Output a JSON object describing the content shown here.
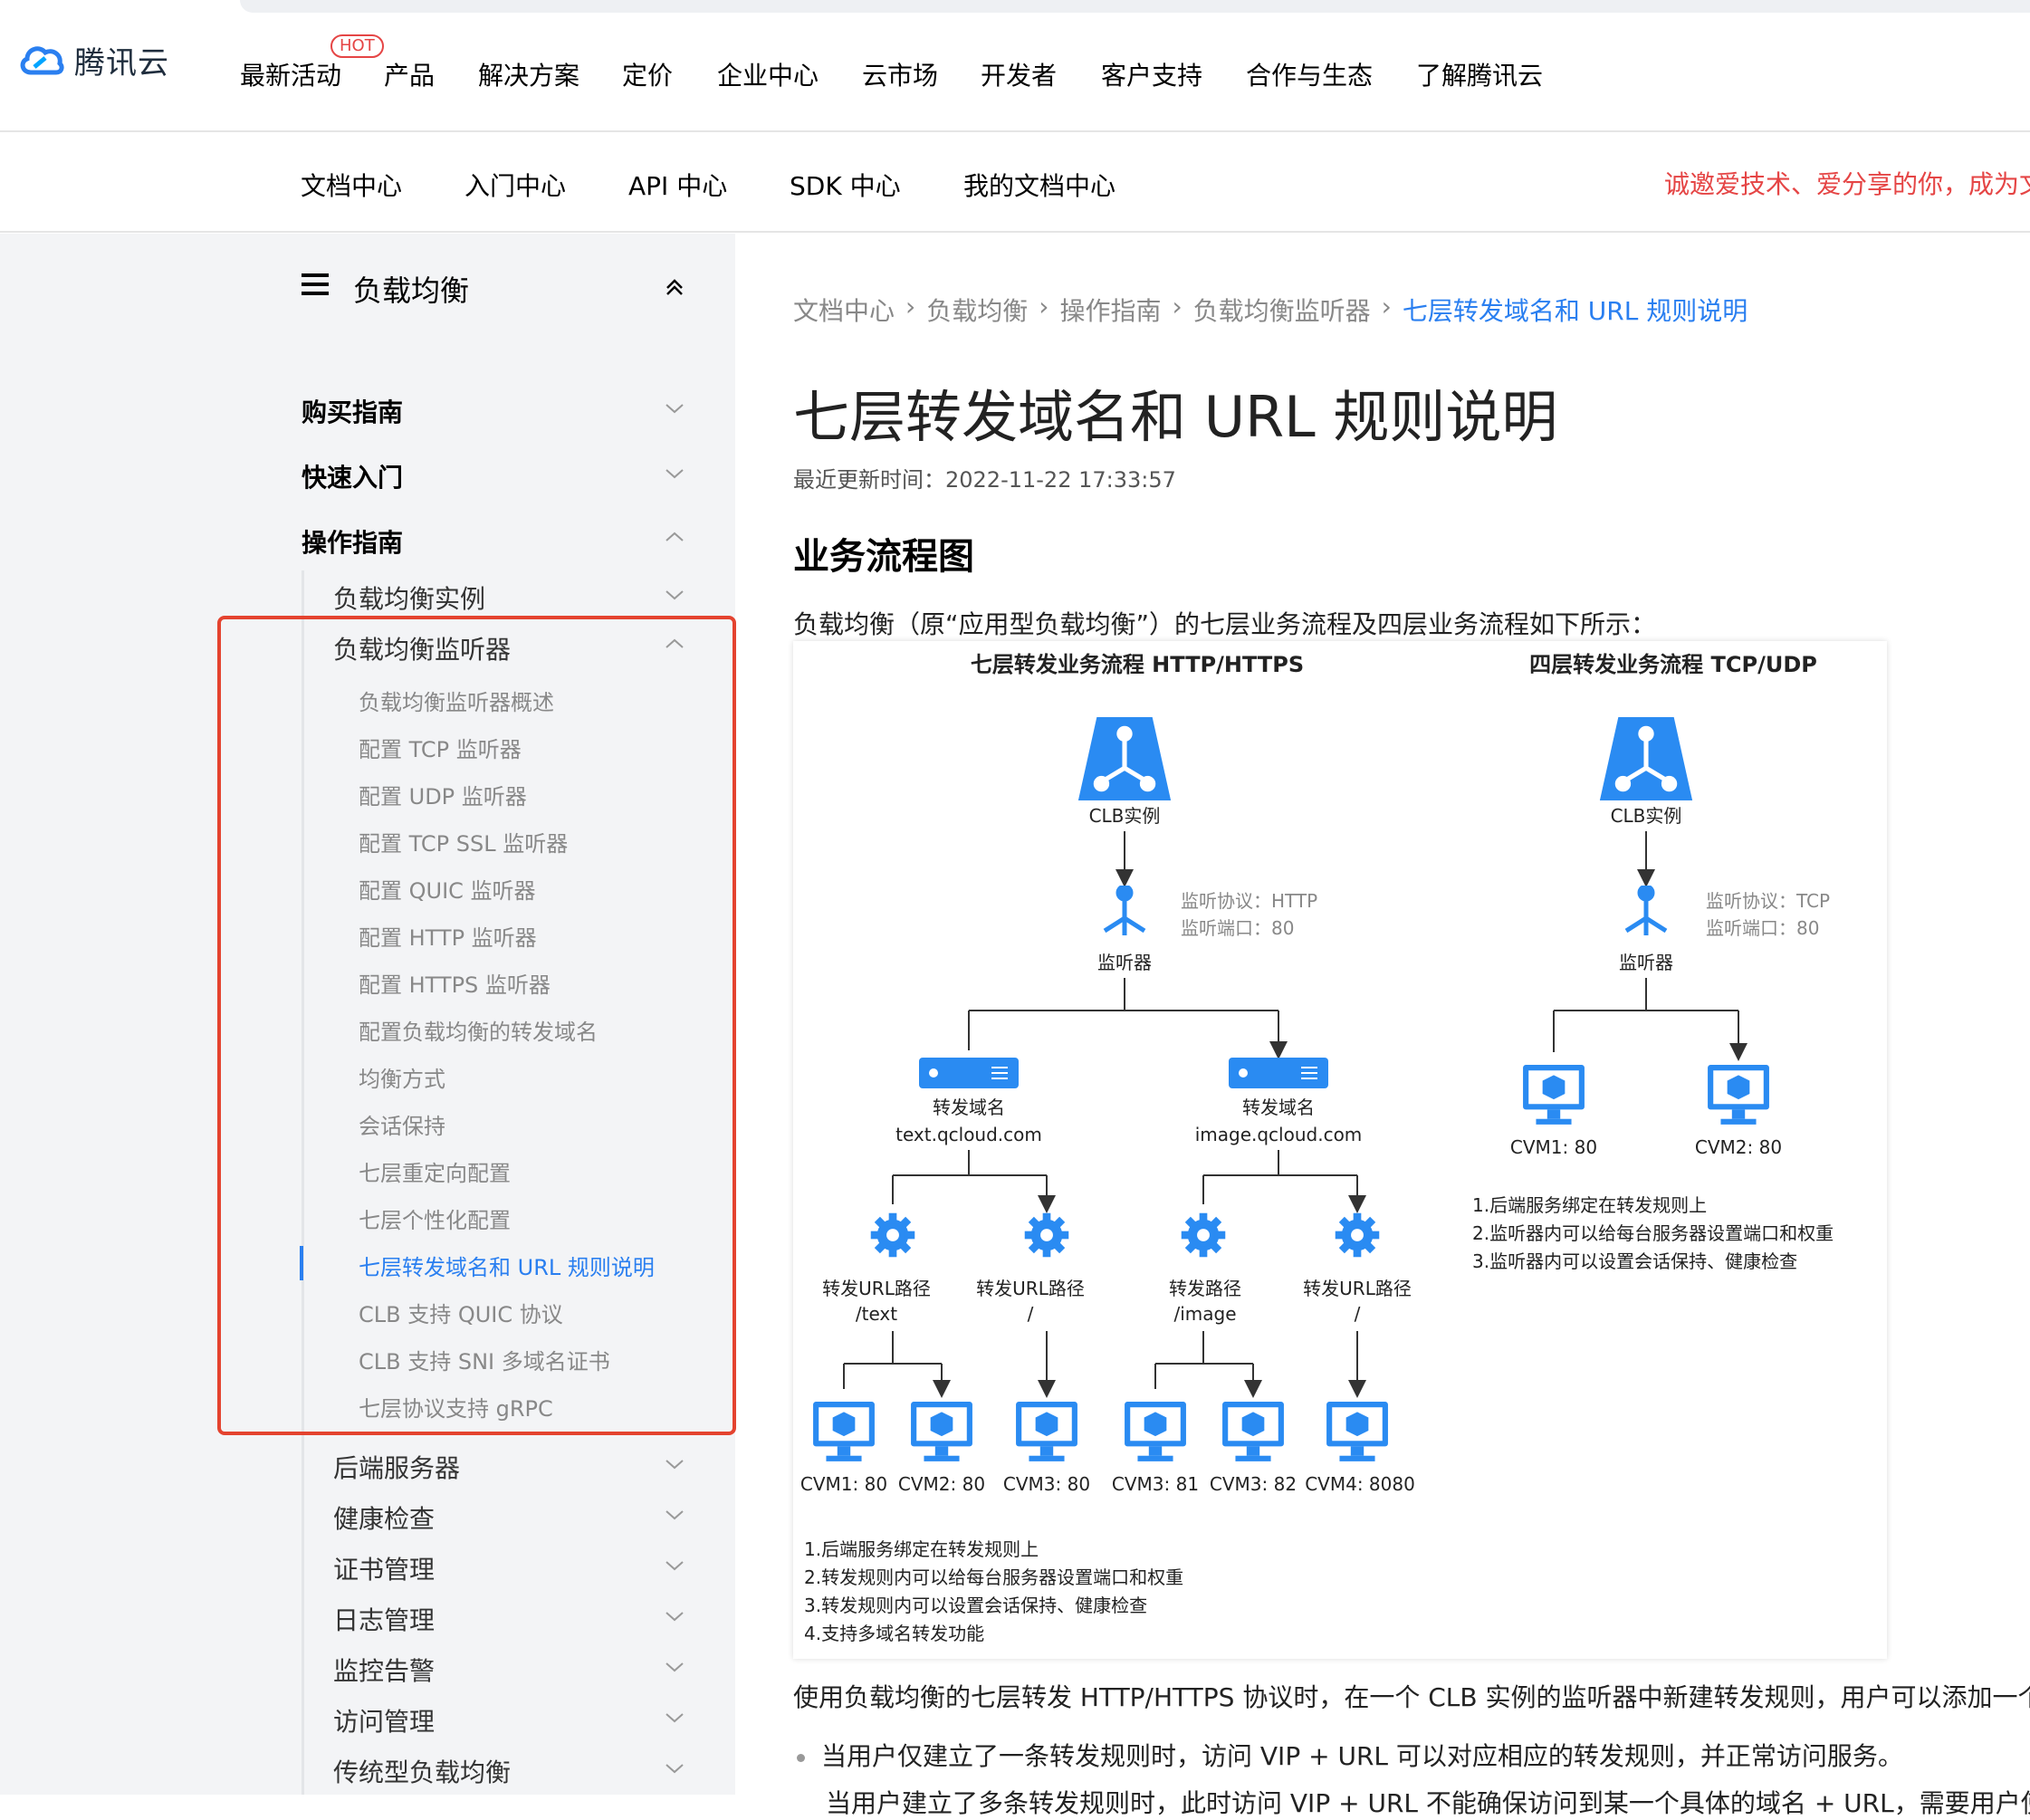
{
  "brand": {
    "name": "腾讯云",
    "hot_badge": "HOT"
  },
  "topnav": [
    "最新活动",
    "产品",
    "解决方案",
    "定价",
    "企业中心",
    "云市场",
    "开发者",
    "客户支持",
    "合作与生态",
    "了解腾讯云"
  ],
  "subnav": [
    "文档中心",
    "入门中心",
    "API 中心",
    "SDK 中心",
    "我的文档中心"
  ],
  "promo": "诚邀爱技术、爱分享的你，成为文",
  "sidebar": {
    "title": "负载均衡",
    "sections": [
      "购买指南",
      "快速入门",
      "操作指南"
    ],
    "sub": [
      "负载均衡实例",
      "负载均衡监听器"
    ],
    "listener_items": [
      "负载均衡监听器概述",
      "配置 TCP 监听器",
      "配置 UDP 监听器",
      "配置 TCP SSL 监听器",
      "配置 QUIC 监听器",
      "配置 HTTP 监听器",
      "配置 HTTPS 监听器",
      "配置负载均衡的转发域名",
      "均衡方式",
      "会话保持",
      "七层重定向配置",
      "七层个性化配置",
      "七层转发域名和 URL 规则说明",
      "CLB 支持 QUIC 协议",
      "CLB 支持 SNI 多域名证书",
      "七层协议支持 gRPC"
    ],
    "more": [
      "后端服务器",
      "健康检查",
      "证书管理",
      "日志管理",
      "监控告警",
      "访问管理",
      "传统型负载均衡"
    ]
  },
  "breadcrumb": [
    "文档中心",
    "负载均衡",
    "操作指南",
    "负载均衡监听器",
    "七层转发域名和 URL 规则说明"
  ],
  "article": {
    "title": "七层转发域名和 URL 规则说明",
    "updated": "最近更新时间：2022-11-22 17:33:57",
    "h2": "业务流程图",
    "intro": "负载均衡（原“应用型负载均衡”）的七层业务流程及四层业务流程如下所示：",
    "para2": "使用负载均衡的七层转发 HTTP/HTTPS 协议时，在一个 CLB 实例的监听器中新建转发规则，用户可以添加一个",
    "bullet1": "当用户仅建立了一条转发规则时，访问 VIP + URL 可以对应相应的转发规则，并正常访问服务。",
    "bullet2": "当用户建立了多条转发规则时，此时访问 VIP + URL 不能确保访问到某一个具体的域名 + URL，需要用户使"
  },
  "diagram": {
    "l7_title": "七层转发业务流程 HTTP/HTTPS",
    "l4_title": "四层转发业务流程 TCP/UDP",
    "clb": "CLB实例",
    "listener": "监听器",
    "l7_proto": "监听协议：HTTP",
    "l4_proto": "监听协议：TCP",
    "port": "监听端口：80",
    "domain_label": "转发域名",
    "domain1": "text.qcloud.com",
    "domain2": "image.qcloud.com",
    "path_label1": "转发URL路径",
    "path_label2": "转发路径",
    "path1": "/text",
    "path2": "/",
    "path3": "/image",
    "path4": "/",
    "l7_cvms": [
      "CVM1: 80",
      "CVM2: 80",
      "CVM3: 80",
      "CVM3: 81",
      "CVM3: 82",
      "CVM4: 8080"
    ],
    "l4_cvms": [
      "CVM1: 80",
      "CVM2: 80"
    ],
    "l7_notes": [
      "1.后端服务绑定在转发规则上",
      "2.转发规则内可以给每台服务器设置端口和权重",
      "3.转发规则内可以设置会话保持、健康检查",
      "4.支持多域名转发功能"
    ],
    "l4_notes": [
      "1.后端服务绑定在转发规则上",
      "2.监听器内可以给每台服务器设置端口和权重",
      "3.监听器内可以设置会话保持、健康检查"
    ],
    "colors": {
      "blue": "#2a8bf2",
      "line": "#555555"
    }
  }
}
